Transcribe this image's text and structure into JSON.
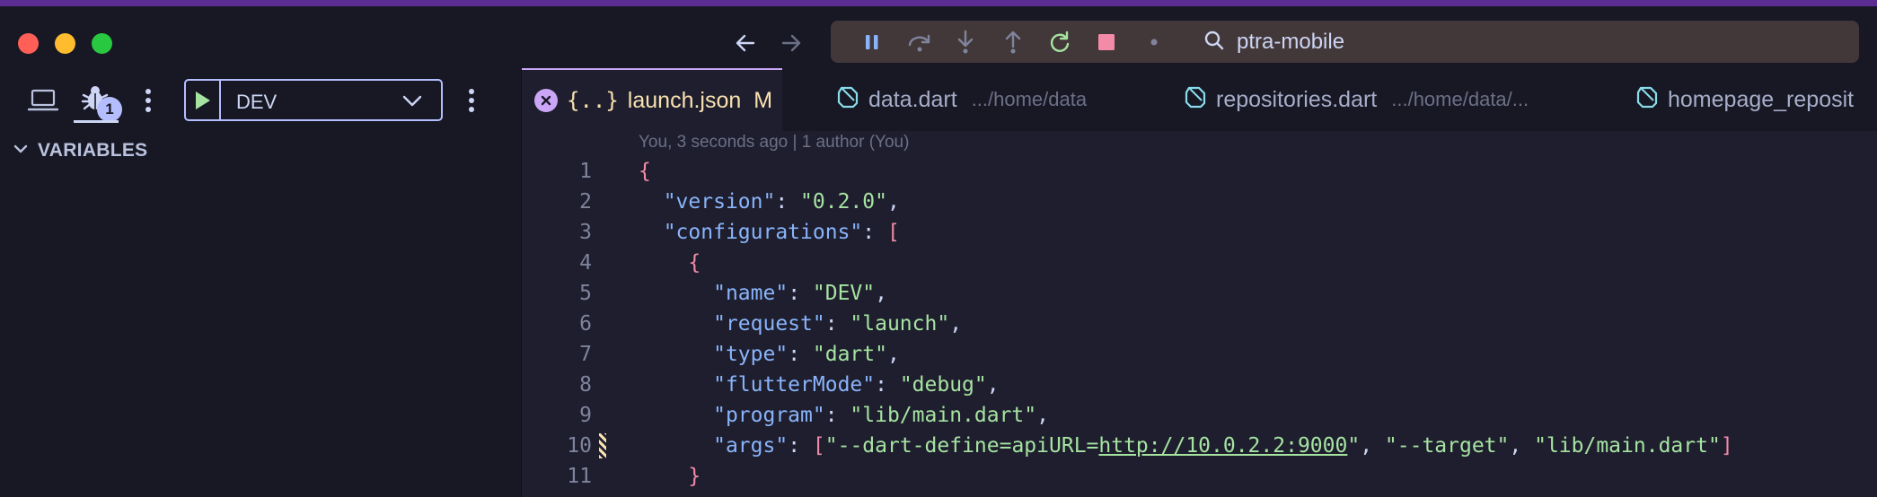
{
  "titlebar": {
    "search_text": "ptra-mobile",
    "colors": {
      "close": "#ff5f57",
      "minimize": "#febc2e",
      "zoom": "#28c840"
    }
  },
  "sidebar": {
    "debug_badge": "1",
    "launch_config": "DEV",
    "section_label": "VARIABLES"
  },
  "tabs": [
    {
      "name": "launch.json",
      "path": "",
      "modified": "M",
      "active": true
    },
    {
      "name": "data.dart",
      "path": ".../home/data",
      "active": false
    },
    {
      "name": "repositories.dart",
      "path": ".../home/data/...",
      "active": false
    },
    {
      "name": "homepage_reposit",
      "path": "",
      "active": false
    }
  ],
  "editor": {
    "blame": "You, 3 seconds ago | 1 author (You)",
    "lines": [
      {
        "n": "1",
        "tokens": [
          {
            "t": "{",
            "c": "brk"
          }
        ]
      },
      {
        "n": "2",
        "tokens": [
          {
            "t": "  "
          },
          {
            "t": "\"version\"",
            "c": "key"
          },
          {
            "t": ": ",
            "c": "pun"
          },
          {
            "t": "\"0.2.0\"",
            "c": "str"
          },
          {
            "t": ",",
            "c": "pun"
          }
        ]
      },
      {
        "n": "3",
        "tokens": [
          {
            "t": "  "
          },
          {
            "t": "\"configurations\"",
            "c": "key"
          },
          {
            "t": ": ",
            "c": "pun"
          },
          {
            "t": "[",
            "c": "brk"
          }
        ]
      },
      {
        "n": "4",
        "tokens": [
          {
            "t": "    "
          },
          {
            "t": "{",
            "c": "brk"
          }
        ]
      },
      {
        "n": "5",
        "tokens": [
          {
            "t": "      "
          },
          {
            "t": "\"name\"",
            "c": "key"
          },
          {
            "t": ": ",
            "c": "pun"
          },
          {
            "t": "\"DEV\"",
            "c": "str"
          },
          {
            "t": ",",
            "c": "pun"
          }
        ]
      },
      {
        "n": "6",
        "tokens": [
          {
            "t": "      "
          },
          {
            "t": "\"request\"",
            "c": "key"
          },
          {
            "t": ": ",
            "c": "pun"
          },
          {
            "t": "\"launch\"",
            "c": "str"
          },
          {
            "t": ",",
            "c": "pun"
          }
        ]
      },
      {
        "n": "7",
        "tokens": [
          {
            "t": "      "
          },
          {
            "t": "\"type\"",
            "c": "key"
          },
          {
            "t": ": ",
            "c": "pun"
          },
          {
            "t": "\"dart\"",
            "c": "str"
          },
          {
            "t": ",",
            "c": "pun"
          }
        ]
      },
      {
        "n": "8",
        "tokens": [
          {
            "t": "      "
          },
          {
            "t": "\"flutterMode\"",
            "c": "key"
          },
          {
            "t": ": ",
            "c": "pun"
          },
          {
            "t": "\"debug\"",
            "c": "str"
          },
          {
            "t": ",",
            "c": "pun"
          }
        ]
      },
      {
        "n": "9",
        "tokens": [
          {
            "t": "      "
          },
          {
            "t": "\"program\"",
            "c": "key"
          },
          {
            "t": ": ",
            "c": "pun"
          },
          {
            "t": "\"lib/main.dart\"",
            "c": "str"
          },
          {
            "t": ",",
            "c": "pun"
          }
        ]
      },
      {
        "n": "10",
        "tokens": [
          {
            "t": "      "
          },
          {
            "t": "\"args\"",
            "c": "key"
          },
          {
            "t": ": ",
            "c": "pun"
          },
          {
            "t": "[",
            "c": "brk"
          },
          {
            "t": "\"--dart-define=apiURL=",
            "c": "str"
          },
          {
            "t": "http://10.0.2.2:9000",
            "c": "url"
          },
          {
            "t": "\"",
            "c": "str"
          },
          {
            "t": ", ",
            "c": "pun"
          },
          {
            "t": "\"--target\"",
            "c": "str"
          },
          {
            "t": ", ",
            "c": "pun"
          },
          {
            "t": "\"lib/main.dart\"",
            "c": "str"
          },
          {
            "t": "]",
            "c": "brk"
          }
        ]
      },
      {
        "n": "11",
        "tokens": [
          {
            "t": "    "
          },
          {
            "t": "}",
            "c": "brk"
          }
        ]
      }
    ]
  }
}
